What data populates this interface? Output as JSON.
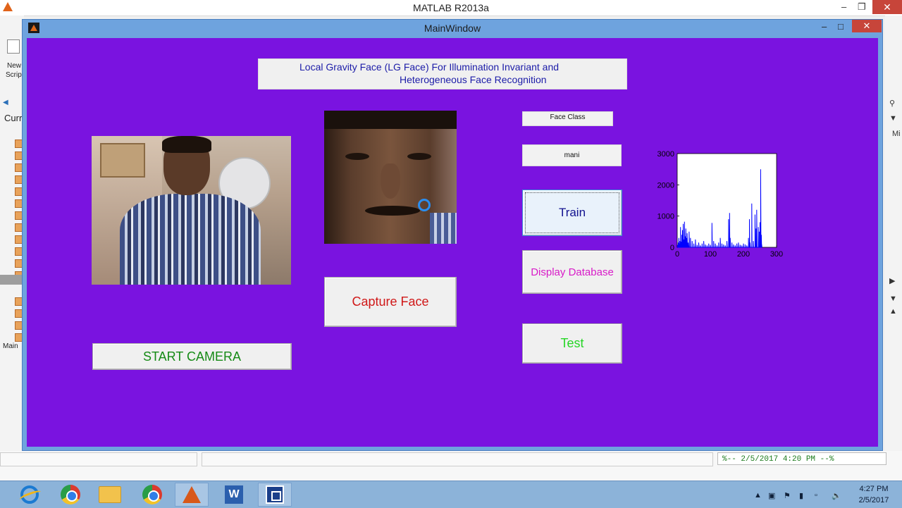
{
  "matlab": {
    "title": "MATLAB R2013a",
    "left_labels": [
      "New",
      "Scrip",
      "Curr",
      "Main"
    ],
    "right_label": "Mi",
    "command_history": "%-- 2/5/2017 4:20 PM --%"
  },
  "main_window": {
    "title": "MainWindow",
    "gui_title_line1": "Local Gravity Face (LG Face) For Illumination Invariant and",
    "gui_title_line2": "Heterogeneous Face Recognition",
    "buttons": {
      "start_camera": "START CAMERA",
      "capture_face": "Capture Face",
      "train": "Train",
      "display_database": "Display Database",
      "test": "Test"
    },
    "face_class_label": "Face Class",
    "face_class_value": "mani",
    "colors": {
      "background": "#7a13e0",
      "title_text": "#1c1ca8",
      "start_camera_text": "#158a15",
      "capture_face_text": "#d01818",
      "train_text": "#12128f",
      "display_database_text": "#d81ac8",
      "test_text": "#26d626"
    }
  },
  "chart_data": {
    "type": "line",
    "title": "",
    "xlabel": "",
    "ylabel": "",
    "xlim": [
      0,
      300
    ],
    "ylim": [
      0,
      3000
    ],
    "xticks": [
      0,
      100,
      200,
      300
    ],
    "yticks": [
      0,
      1000,
      2000,
      3000
    ],
    "series": [
      {
        "color": "#0000ff",
        "x": [
          1,
          3,
          5,
          6,
          8,
          10,
          12,
          14,
          16,
          18,
          20,
          22,
          24,
          26,
          28,
          30,
          33,
          36,
          40,
          45,
          50,
          55,
          60,
          65,
          70,
          75,
          80,
          85,
          90,
          95,
          100,
          105,
          110,
          115,
          120,
          125,
          130,
          135,
          140,
          145,
          150,
          155,
          158,
          160,
          165,
          170,
          175,
          180,
          185,
          190,
          195,
          200,
          205,
          210,
          215,
          218,
          220,
          225,
          230,
          235,
          238,
          240,
          245,
          248,
          250,
          252,
          254,
          255
        ],
        "y": [
          80,
          150,
          300,
          120,
          200,
          650,
          180,
          400,
          550,
          750,
          250,
          820,
          350,
          600,
          300,
          450,
          150,
          500,
          300,
          200,
          120,
          250,
          80,
          150,
          60,
          120,
          200,
          90,
          60,
          120,
          80,
          780,
          200,
          120,
          60,
          150,
          300,
          120,
          90,
          60,
          200,
          900,
          1100,
          300,
          150,
          90,
          60,
          120,
          150,
          80,
          60,
          120,
          90,
          60,
          300,
          900,
          150,
          1400,
          200,
          1050,
          600,
          1200,
          650,
          500,
          800,
          2500,
          400,
          100
        ]
      }
    ]
  }
}
